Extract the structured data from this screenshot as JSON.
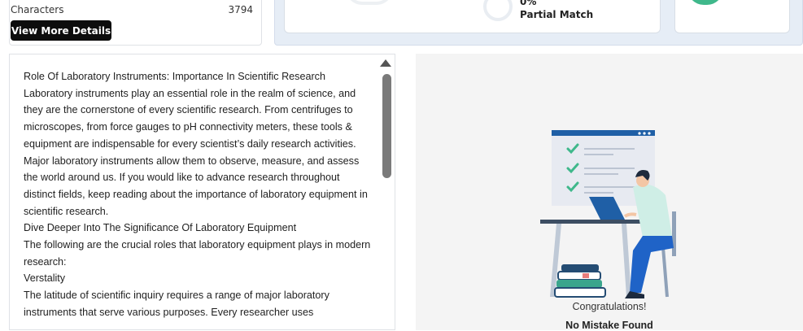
{
  "stats": {
    "characters_label": "Characters",
    "characters_value": "3794",
    "view_details_label": "View More Details"
  },
  "results": {
    "partial_match_percent": "0%",
    "partial_match_label": "Partial Match"
  },
  "content": {
    "paragraphs": [
      "Role Of Laboratory Instruments: Importance In Scientific Research",
      "Laboratory instruments play an essential role in the realm of science, and they are the cornerstone of every scientific research. From centrifuges to microscopes, from force gauges to pH connectivity meters, these tools & equipment are indispensable for every scientist’s daily research activities. Major laboratory instruments allow them to observe, measure, and assess the world around us. If you would like to advance research throughout distinct fields, keep reading about the importance of laboratory equipment in scientific research.",
      "Dive Deeper Into The Significance Of Laboratory Equipment",
      "The following are the crucial roles that laboratory equipment plays in modern research:",
      "Verstality",
      "The latitude of scientific inquiry requires a range of major laboratory instruments that serve various purposes. Every researcher uses"
    ]
  },
  "result_message": {
    "title": "Congratulations!",
    "subtitle": "No Mistake Found"
  },
  "colors": {
    "accent_green": "#3fb88b",
    "button_black": "#0d0d0d",
    "checklist_blue": "#1f5fa6",
    "panel_blue": "#e6edf6"
  }
}
